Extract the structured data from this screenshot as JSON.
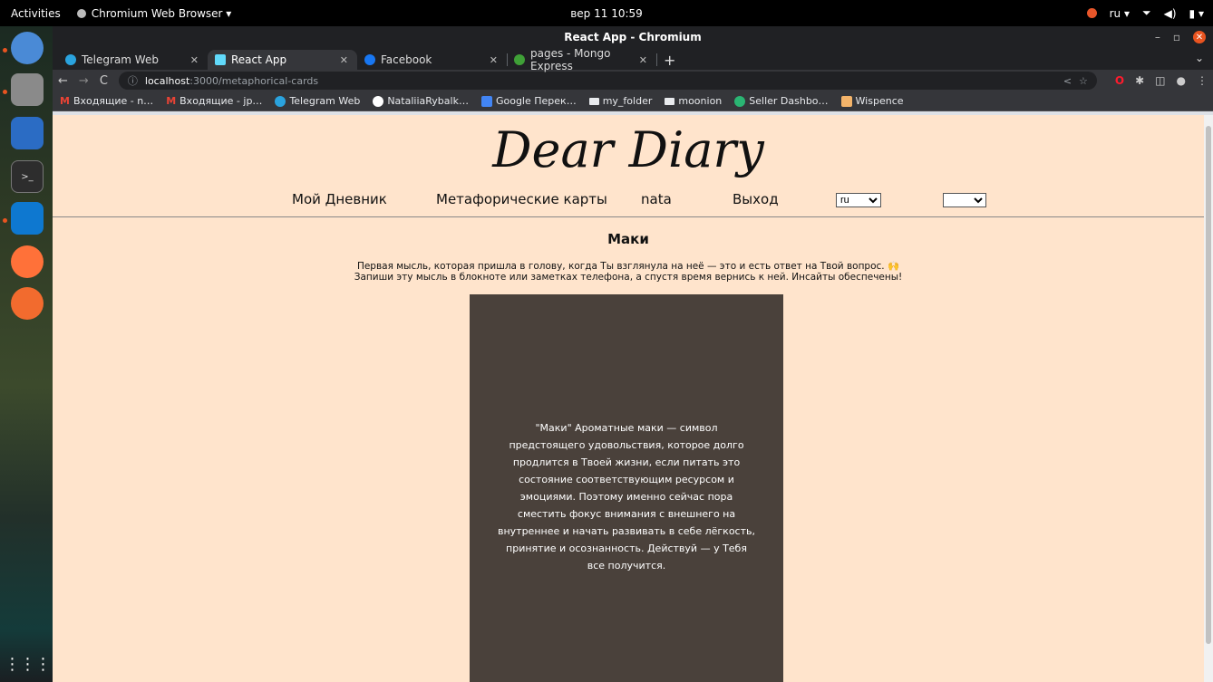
{
  "system": {
    "activities": "Activities",
    "app_menu": "Chromium Web Browser ▾",
    "clock": "вер 11  10:59",
    "lang": "ru ▾"
  },
  "window": {
    "title": "React App - Chromium"
  },
  "tabs": [
    {
      "label": "Telegram Web",
      "color": "#2aa3de"
    },
    {
      "label": "React App",
      "color": "#61dafb"
    },
    {
      "label": "Facebook",
      "color": "#1877f2"
    },
    {
      "label": "pages - Mongo Express",
      "color": "#3fa037"
    }
  ],
  "address": {
    "host": "localhost",
    "path": ":3000/metaphorical-cards"
  },
  "bookmarks": [
    {
      "label": "Входящие - n…",
      "icon": "gmail-icon"
    },
    {
      "label": "Входящие - jp…",
      "icon": "gmail-icon"
    },
    {
      "label": "Telegram Web",
      "icon": "telegram-icon"
    },
    {
      "label": "NataliiaRybalk…",
      "icon": "github-icon"
    },
    {
      "label": "Google Перек…",
      "icon": "translate-icon"
    },
    {
      "label": "my_folder",
      "icon": "folder-icon"
    },
    {
      "label": "moonion",
      "icon": "folder-icon"
    },
    {
      "label": "Seller Dashbo…",
      "icon": "seller-icon"
    },
    {
      "label": "Wispence",
      "icon": "wispence-icon"
    }
  ],
  "page": {
    "brand": "Dear Diary",
    "nav": {
      "diary": "Мой Дневник",
      "cards": "Метафорические карты",
      "user": "nata",
      "logout": "Выход",
      "lang_value": "ru",
      "second_value": ""
    },
    "heading": "Маки",
    "intro_line1": "Первая мысль, которая пришла в голову, когда Ты взглянула на неё — это и есть ответ на Твой вопрос. 🙌",
    "intro_line2": "Запиши эту мысль в блокноте или заметках телефона, а спустя время вернись к ней. Инсайты обеспечены!",
    "card_text": "\"Маки\" Ароматные маки — символ предстоящего удовольствия, которое долго продлится в Твоей жизни, если питать это состояние соответствующим ресурсом и эмоциями. Поэтому именно сейчас пора сместить фокус внимания с внешнего на внутреннее и начать развивать в себе лёгкость, принятие и осознанность. Действуй — у Тебя все получится.",
    "card_bg": "#4a413b",
    "page_bg": "#ffe4cc"
  }
}
